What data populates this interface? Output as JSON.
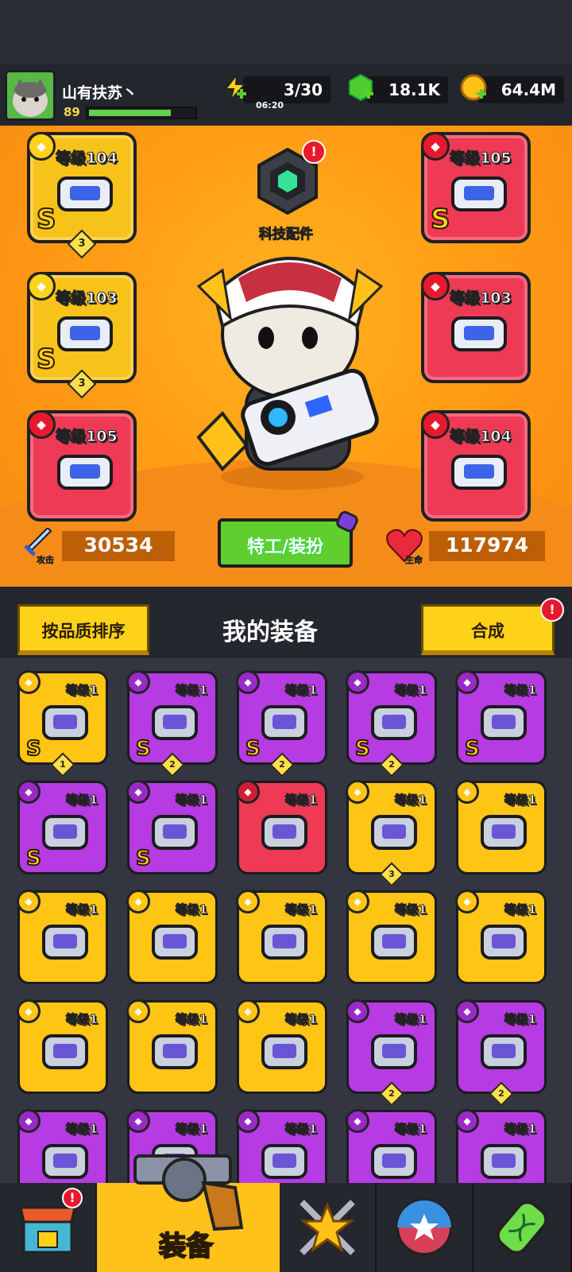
{
  "player": {
    "name": "山有扶苏丶",
    "level": "89",
    "xp_fraction": 0.78
  },
  "resources": {
    "energy": {
      "value": "3/30",
      "timer": "06:20",
      "icon": "lightning-icon"
    },
    "gems": {
      "value": "18.1K",
      "icon": "green-gem-icon"
    },
    "coins": {
      "value": "64.4M",
      "icon": "gold-coin-icon"
    }
  },
  "tech_parts": {
    "label": "科技配件",
    "alert": "!"
  },
  "equipped": [
    {
      "slot": "weapon",
      "level": "等级104",
      "grade": "S",
      "stars": "3",
      "color": "yellow",
      "icon": "blaster-gun-icon"
    },
    {
      "slot": "armor",
      "level": "等级105",
      "grade": "S",
      "stars": "",
      "color": "red",
      "icon": "robot-armor-icon"
    },
    {
      "slot": "necklace",
      "level": "等级103",
      "grade": "S",
      "stars": "3",
      "color": "yellow",
      "icon": "star-ring-icon"
    },
    {
      "slot": "belt",
      "level": "等级103",
      "grade": "",
      "stars": "",
      "color": "red",
      "icon": "star-belt-icon"
    },
    {
      "slot": "glove",
      "level": "等级105",
      "grade": "",
      "stars": "",
      "color": "red",
      "icon": "metal-gauntlet-icon"
    },
    {
      "slot": "boots",
      "level": "等级104",
      "grade": "",
      "stars": "",
      "color": "red",
      "icon": "purple-boots-icon"
    }
  ],
  "stats": {
    "attack_label": "攻击",
    "attack": "30534",
    "hp_label": "生命",
    "hp": "117974"
  },
  "agent_button": "特工/装扮",
  "sort_button": "按品质排序",
  "inventory_title": "我的装备",
  "merge_button": "合成",
  "merge_alert": "!",
  "inventory": [
    {
      "level": "等级1",
      "color": "yellow",
      "grade": "S",
      "stars": "1",
      "icon": "star-ring-icon"
    },
    {
      "level": "等级1",
      "color": "purple",
      "grade": "S",
      "stars": "2",
      "icon": "cyber-gauntlet-icon"
    },
    {
      "level": "等级1",
      "color": "purple",
      "grade": "S",
      "stars": "2",
      "icon": "dark-gauntlet-icon"
    },
    {
      "level": "等级1",
      "color": "purple",
      "grade": "S",
      "stars": "2",
      "icon": "armored-boots-icon"
    },
    {
      "level": "等级1",
      "color": "purple",
      "grade": "S",
      "stars": "",
      "icon": "flame-sword-icon"
    },
    {
      "level": "等级1",
      "color": "purple",
      "grade": "S",
      "stars": "",
      "icon": "blaster-gun-icon"
    },
    {
      "level": "等级1",
      "color": "purple",
      "grade": "S",
      "stars": "",
      "icon": "dark-boots-icon"
    },
    {
      "level": "等级1",
      "color": "red",
      "grade": "",
      "stars": "",
      "icon": "kunai-icon"
    },
    {
      "level": "等级1",
      "color": "yellow",
      "grade": "",
      "stars": "3",
      "icon": "steel-armor-icon"
    },
    {
      "level": "等级1",
      "color": "yellow",
      "grade": "",
      "stars": "",
      "icon": "steel-armor-icon"
    },
    {
      "level": "等级1",
      "color": "yellow",
      "grade": "",
      "stars": "",
      "icon": "spiked-collar-icon"
    },
    {
      "level": "等级1",
      "color": "yellow",
      "grade": "",
      "stars": "",
      "icon": "lock-necklace-icon"
    },
    {
      "level": "等级1",
      "color": "yellow",
      "grade": "",
      "stars": "",
      "icon": "lock-necklace-icon"
    },
    {
      "level": "等级1",
      "color": "yellow",
      "grade": "",
      "stars": "",
      "icon": "rope-belt-icon"
    },
    {
      "level": "等级1",
      "color": "yellow",
      "grade": "",
      "stars": "",
      "icon": "rope-belt-icon"
    },
    {
      "level": "等级1",
      "color": "yellow",
      "grade": "",
      "stars": "",
      "icon": "purple-gauntlet-icon"
    },
    {
      "level": "等级1",
      "color": "yellow",
      "grade": "",
      "stars": "",
      "icon": "purple-gauntlet-icon"
    },
    {
      "level": "等级1",
      "color": "yellow",
      "grade": "",
      "stars": "",
      "icon": "purple-gauntlet-icon"
    },
    {
      "level": "等级1",
      "color": "purple",
      "grade": "",
      "stars": "2",
      "icon": "steel-armor-icon"
    },
    {
      "level": "等级1",
      "color": "purple",
      "grade": "",
      "stars": "2",
      "icon": "rope-belt-icon"
    },
    {
      "level": "等级1",
      "color": "purple",
      "grade": "",
      "stars": "",
      "icon": "steel-armor-icon"
    },
    {
      "level": "等级1",
      "color": "purple",
      "grade": "",
      "stars": "",
      "icon": "weapon-icon"
    },
    {
      "level": "等级1",
      "color": "purple",
      "grade": "",
      "stars": "",
      "icon": "blaster-gun-icon"
    },
    {
      "level": "等级1",
      "color": "purple",
      "grade": "",
      "stars": "",
      "icon": "rifle-icon"
    },
    {
      "level": "等级1",
      "color": "purple",
      "grade": "",
      "stars": "",
      "icon": "hammer-icon"
    }
  ],
  "nav": [
    {
      "label": "",
      "icon": "shop-icon",
      "alert": "!"
    },
    {
      "label": "装备",
      "icon": "revolver-icon",
      "selected": true
    },
    {
      "label": "",
      "icon": "star-swords-icon"
    },
    {
      "label": "",
      "icon": "star-ball-icon"
    },
    {
      "label": "",
      "icon": "dna-capsule-icon"
    }
  ],
  "colors": {
    "yellow": "#ffc515",
    "purple": "#b63be3",
    "red": "#ee3a55",
    "orange_bg": "#ff9a14",
    "green_button": "#5fce2e"
  }
}
